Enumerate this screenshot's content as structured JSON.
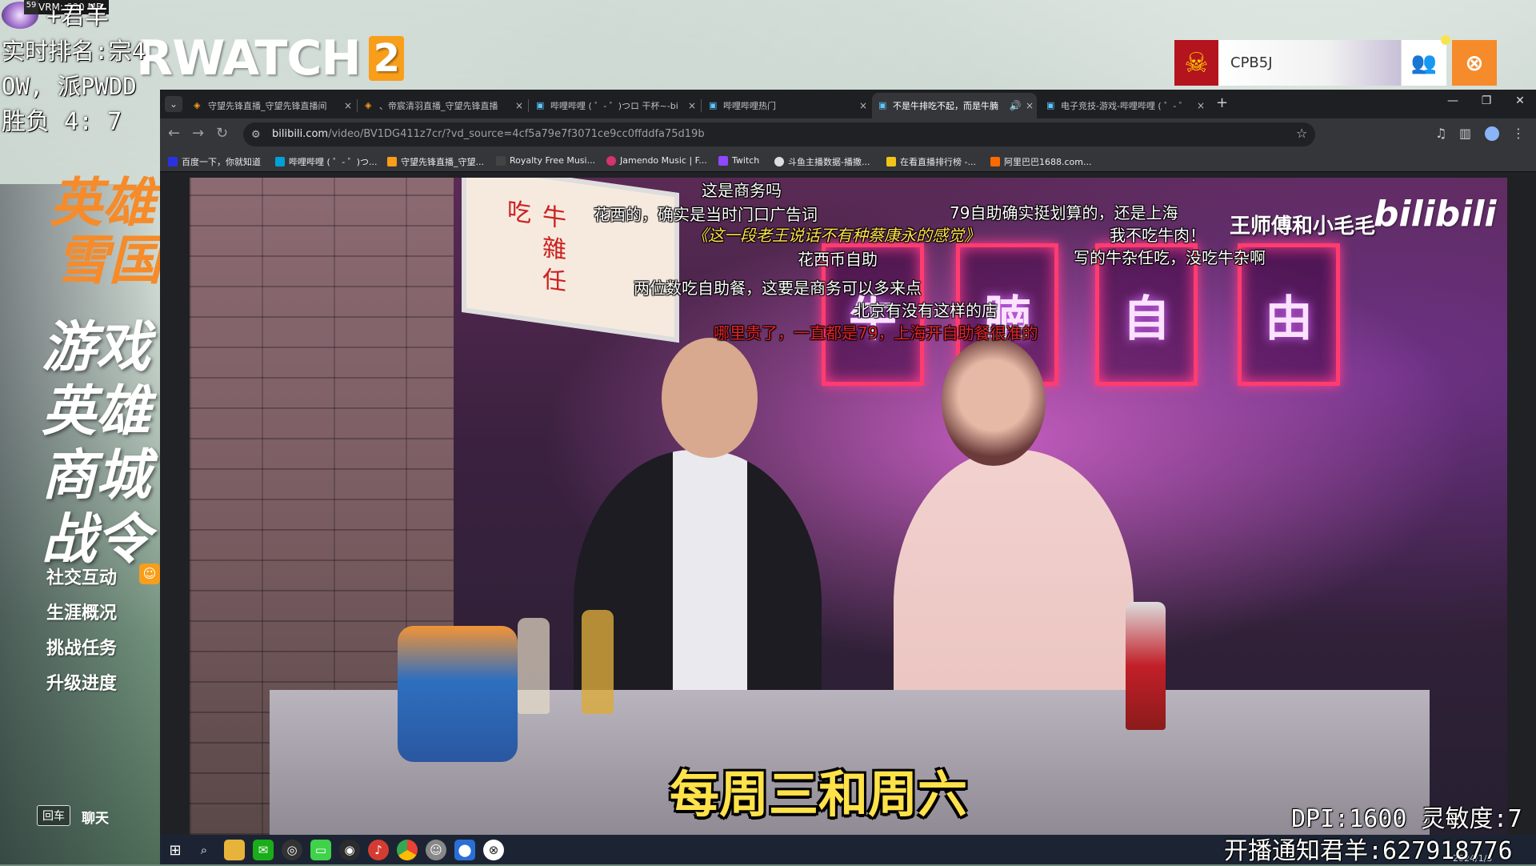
{
  "overlay": {
    "vram": "VRM: 600 MB",
    "vram_prefix": "59",
    "streamer": "+君羊",
    "rank": "实时排名:宗4",
    "server": "OW, 派PWDD",
    "record": "胜负 4: 7",
    "dpi": "DPI:1600 灵敏度:7",
    "notice": "开播通知君羊:627918776"
  },
  "game": {
    "logo_text": "RWATCH",
    "logo_num": "2",
    "hero_title_1": "英雄",
    "hero_title_2": "雪国",
    "menu_big": [
      "游戏",
      "英雄",
      "商城",
      "战令"
    ],
    "menu_small": [
      "社交互动",
      "生涯概况",
      "挑战任务",
      "升级进度"
    ],
    "enter_key": "回车",
    "chat": "聊天",
    "player_name": "CPB5J"
  },
  "browser": {
    "tabs": [
      {
        "title": "守望先锋直播_守望先锋直播间"
      },
      {
        "title": "、帝宸清羽直播_守望先锋直播"
      },
      {
        "title": "哔哩哔哩 ( ゜- ゜)つロ 干杯~-bi"
      },
      {
        "title": "哔哩哔哩热门"
      },
      {
        "title": "不是牛排吃不起，而是牛腩"
      },
      {
        "title": "电子竞技-游戏-哔哩哔哩 ( ゜- ゜"
      }
    ],
    "url_main": "bilibili.com",
    "url_rest": "/video/BV1DG411z7cr/?vd_source=4cf5a79e7f3071ce9cc0ffddfa75d19b",
    "bookmarks": [
      "百度一下，你就知道",
      "哔哩哔哩 ( ゜- ゜)つ...",
      "守望先锋直播_守望...",
      "Royalty Free Musi...",
      "Jamendo Music | F...",
      "Twitch",
      "斗鱼主播数据-播撒...",
      "在看直播排行榜 -...",
      "阿里巴巴1688.com..."
    ]
  },
  "video": {
    "uploader": "王师傅和小毛毛",
    "logo": "bilibili",
    "caption": "每周三和周六",
    "danmaku": [
      "这是商务吗",
      "花西的，确实是当时门口广告词",
      "79自助确实挺划算的，还是上海",
      "《这一段老王说话不有种蔡康永的感觉》",
      "我不吃牛肉！",
      "写的牛杂任吃，没吃牛杂啊",
      "花西币自助",
      "两位数吃自助餐，这要是商务可以多来点",
      "北京有没有这样的店",
      "哪里贵了，一直都是79，上海开自助餐很准的"
    ],
    "neon_chars": [
      "牛",
      "腩",
      "自",
      "由"
    ],
    "sign_text": "牛 雜 任 吃",
    "date": "2024/1/3"
  }
}
